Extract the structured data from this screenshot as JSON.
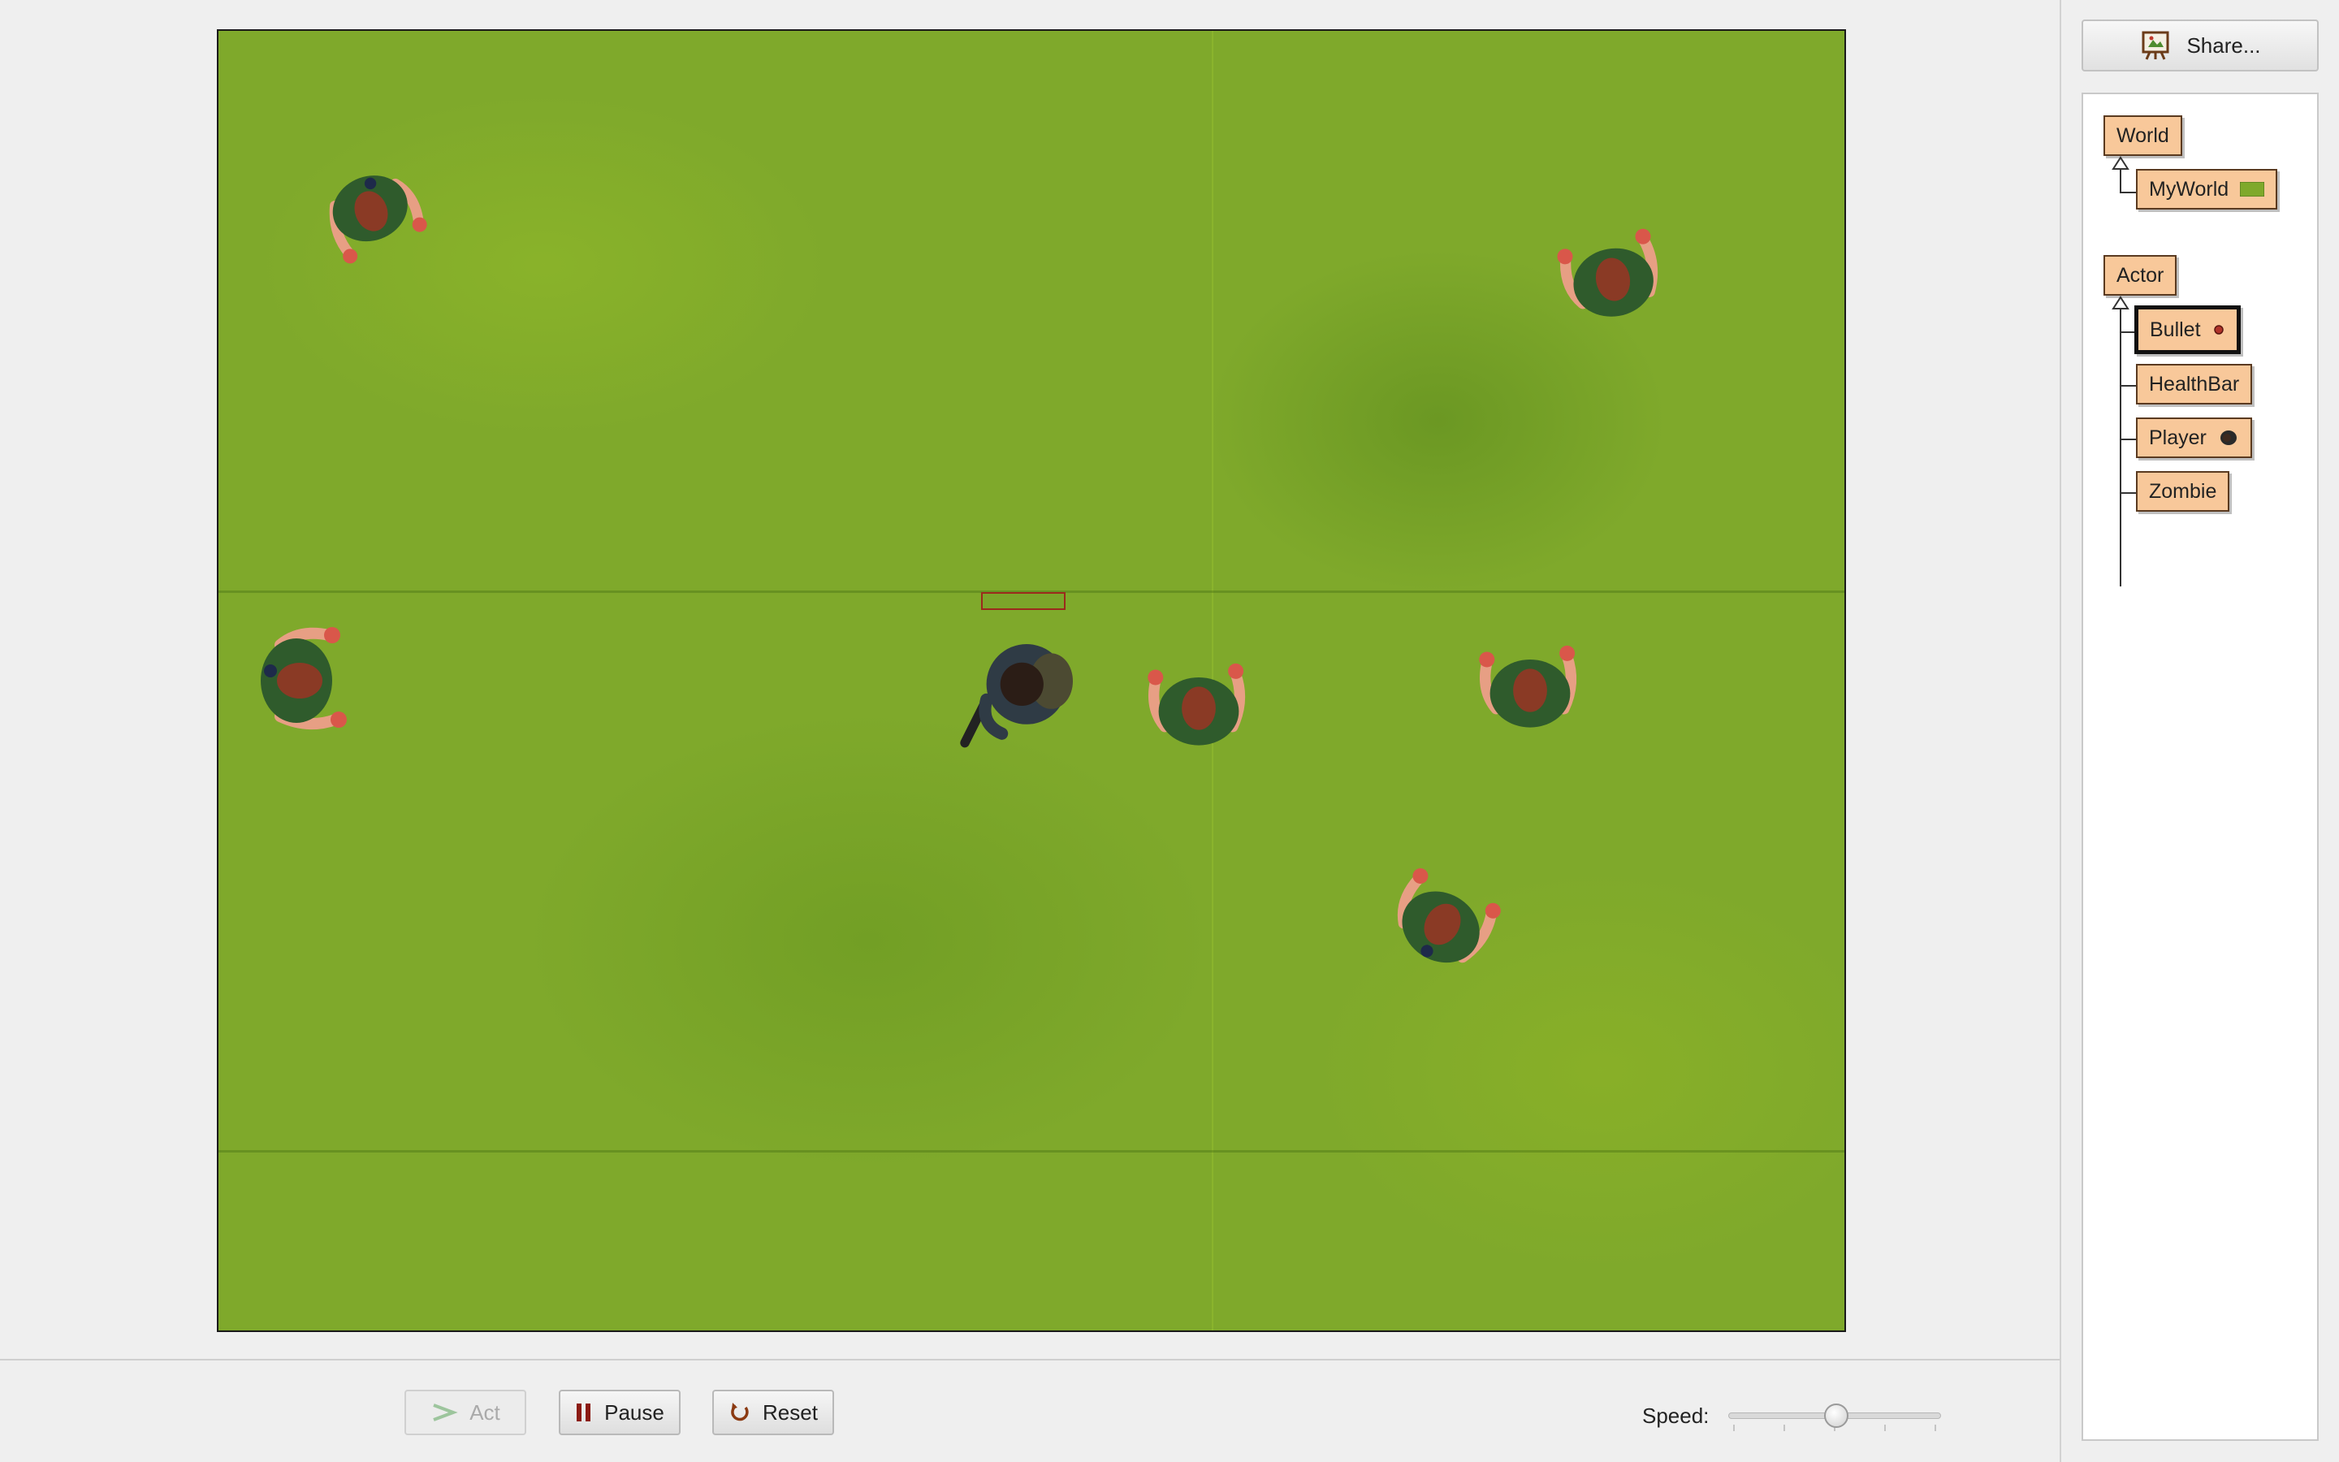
{
  "controls": {
    "act_label": "Act",
    "pause_label": "Pause",
    "reset_label": "Reset",
    "speed_label": "Speed:",
    "speed_level": 0.5
  },
  "share": {
    "label": "Share..."
  },
  "class_tree": {
    "world_root": "World",
    "world_classes": [
      "MyWorld"
    ],
    "actor_root": "Actor",
    "actor_classes": [
      "Bullet",
      "HealthBar",
      "Player",
      "Zombie"
    ],
    "selected": "Bullet"
  },
  "colors": {
    "class_box": "#f8c89a",
    "grass": "#7fa92b",
    "zombie_shirt": "#2f5b2c",
    "zombie_skin": "#e79f84",
    "healthbar_border": "#9b2a1c"
  },
  "icons": {
    "act": "step-arrow-icon",
    "pause": "pause-icon",
    "reset": "reset-icon",
    "share": "scenario-board-icon"
  }
}
